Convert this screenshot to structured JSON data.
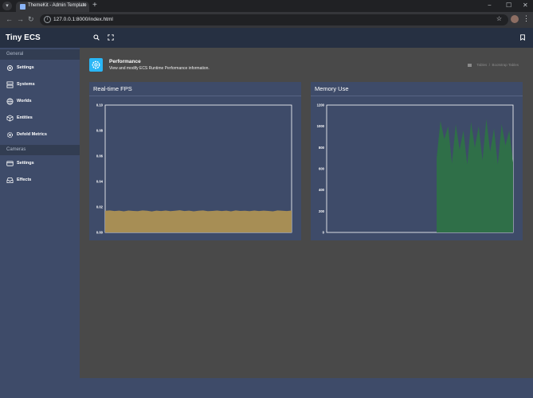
{
  "browser": {
    "tab_title": "ThemeKit - Admin Template",
    "url": "127.0.0.1:8000/index.html"
  },
  "sidebar": {
    "brand": "Tiny ECS",
    "sections": [
      {
        "title": "General",
        "items": [
          {
            "label": "Settings",
            "icon": "gear-icon"
          },
          {
            "label": "Systems",
            "icon": "server-icon"
          },
          {
            "label": "Worlds",
            "icon": "globe-icon"
          },
          {
            "label": "Entities",
            "icon": "cube-icon"
          },
          {
            "label": "Defold Metrics",
            "icon": "cog-icon"
          }
        ]
      },
      {
        "title": "Cameras",
        "items": [
          {
            "label": "Settings",
            "icon": "credit-card-icon"
          },
          {
            "label": "Effects",
            "icon": "inbox-icon"
          }
        ]
      }
    ]
  },
  "topbar": {
    "icons": [
      "search-icon",
      "fullscreen-icon",
      "bookmark-icon"
    ]
  },
  "page": {
    "title": "Performance",
    "subtitle": "View and modify ECS Runtime Performance information.",
    "breadcrumb": [
      "Tables",
      "Bootstrap Tables"
    ]
  },
  "colors": {
    "sidebar_bg": "#3e4b69",
    "brand_bg": "#263042",
    "main_bg": "#494949",
    "accent": "#29b6f6",
    "fps_fill": "#a78e55",
    "memory_fill": "#2f6f48"
  },
  "charts": {
    "fps": {
      "title": "Real-time FPS"
    },
    "memory": {
      "title": "Memory Use"
    }
  },
  "chart_data": [
    {
      "type": "area",
      "title": "Real-time FPS",
      "ylim": [
        0,
        0.1
      ],
      "yticks": [
        "0.10",
        "0.08",
        "0.06",
        "0.04",
        "0.02",
        "0.00"
      ],
      "color": "#a78e55",
      "values": [
        0.017,
        0.0173,
        0.0168,
        0.0171,
        0.0166,
        0.0172,
        0.0169,
        0.0167,
        0.0173,
        0.017,
        0.0165,
        0.0171,
        0.0168,
        0.0172,
        0.0167,
        0.017,
        0.0174,
        0.0168,
        0.0171,
        0.0166,
        0.017,
        0.0173,
        0.0167,
        0.0169,
        0.0172,
        0.0168,
        0.0171,
        0.0166,
        0.0173,
        0.0169,
        0.017,
        0.0167,
        0.0172,
        0.0168,
        0.0171,
        0.0169,
        0.0166,
        0.0173,
        0.017,
        0.0168,
        0.0172
      ]
    },
    {
      "type": "area",
      "title": "Memory Use",
      "ylim": [
        0,
        1200
      ],
      "yticks": [
        "1200",
        "1000",
        "800",
        "600",
        "400",
        "200",
        "0"
      ],
      "color": "#2f6f48",
      "start_fraction": 0.59,
      "values": [
        700,
        1050,
        880,
        1000,
        650,
        1020,
        780,
        960,
        640,
        1040,
        800,
        1000,
        680,
        1070,
        760,
        980,
        640,
        1020,
        820,
        960,
        660
      ]
    }
  ]
}
